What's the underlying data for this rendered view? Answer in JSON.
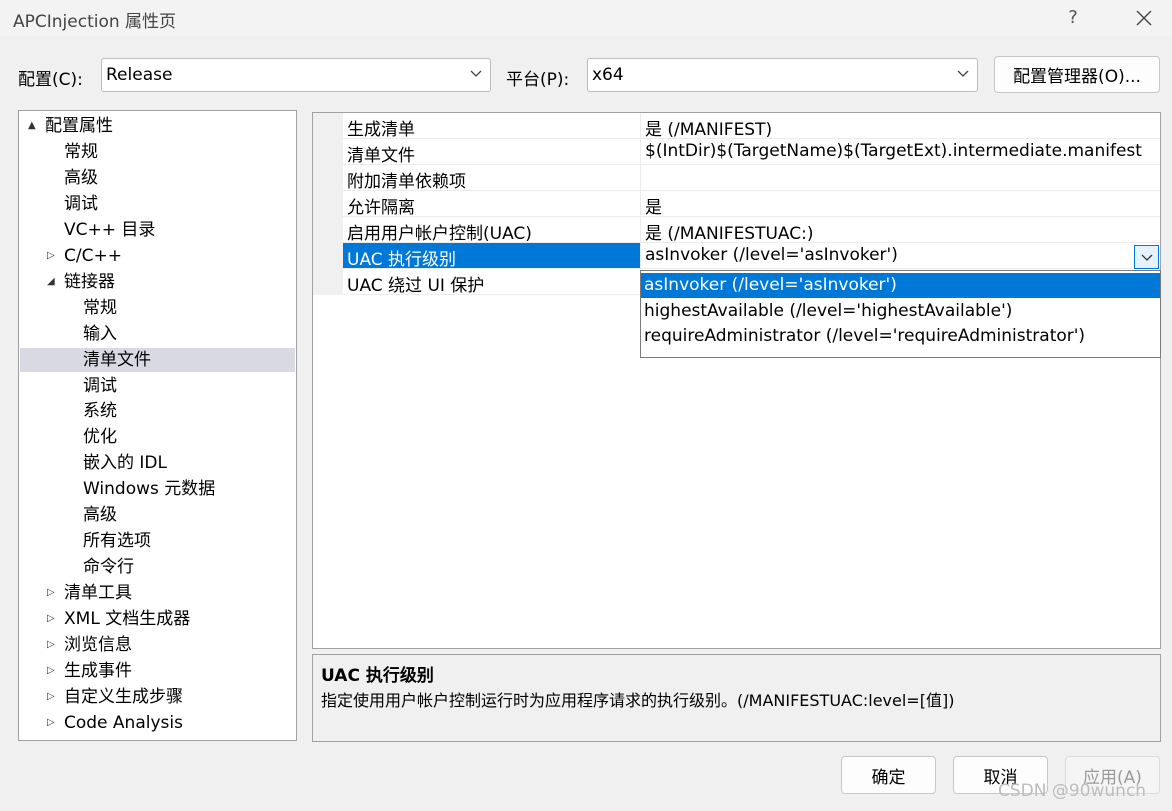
{
  "window": {
    "title": "APCInjection 属性页",
    "help_label": "?"
  },
  "config": {
    "configuration_label": "配置(C):",
    "configuration_value": "Release",
    "platform_label": "平台(P):",
    "platform_value": "x64",
    "manager_button": "配置管理器(O)..."
  },
  "tree": {
    "items": [
      {
        "label": "配置属性",
        "expander": "▲"
      },
      {
        "label": "常规"
      },
      {
        "label": "高级"
      },
      {
        "label": "调试"
      },
      {
        "label": "VC++ 目录"
      },
      {
        "label": "C/C++",
        "expander": "▷"
      },
      {
        "label": "链接器",
        "expander": "◢"
      },
      {
        "label": "常规"
      },
      {
        "label": "输入"
      },
      {
        "label": "清单文件",
        "selected": true
      },
      {
        "label": "调试"
      },
      {
        "label": "系统"
      },
      {
        "label": "优化"
      },
      {
        "label": "嵌入的 IDL"
      },
      {
        "label": "Windows 元数据"
      },
      {
        "label": "高级"
      },
      {
        "label": "所有选项"
      },
      {
        "label": "命令行"
      },
      {
        "label": "清单工具",
        "expander": "▷"
      },
      {
        "label": "XML 文档生成器",
        "expander": "▷"
      },
      {
        "label": "浏览信息",
        "expander": "▷"
      },
      {
        "label": "生成事件",
        "expander": "▷"
      },
      {
        "label": "自定义生成步骤",
        "expander": "▷"
      },
      {
        "label": "Code Analysis",
        "expander": "▷"
      }
    ]
  },
  "properties": {
    "rows": [
      {
        "name": "生成清单",
        "value": "是 (/MANIFEST)"
      },
      {
        "name": "清单文件",
        "value": "$(IntDir)$(TargetName)$(TargetExt).intermediate.manifest"
      },
      {
        "name": "附加清单依赖项",
        "value": ""
      },
      {
        "name": "允许隔离",
        "value": "是"
      },
      {
        "name": "启用用户帐户控制(UAC)",
        "value": "是 (/MANIFESTUAC:)"
      },
      {
        "name": "UAC 执行级别",
        "value": "asInvoker (/level='asInvoker')",
        "selected": true
      },
      {
        "name": "UAC 绕过 UI 保护",
        "value": ""
      }
    ],
    "dropdown_options": [
      "asInvoker (/level='asInvoker')",
      "highestAvailable (/level='highestAvailable')",
      "requireAdministrator (/level='requireAdministrator')"
    ],
    "selected_option_index": 0
  },
  "description": {
    "title": "UAC 执行级别",
    "text": "指定使用用户帐户控制运行时为应用程序请求的执行级别。(/MANIFESTUAC:level=[值])"
  },
  "buttons": {
    "ok": "确定",
    "cancel": "取消",
    "apply": "应用(A)"
  },
  "watermark": "CSDN @90wunch",
  "colors": {
    "selection": "#0078d7",
    "tree_selection": "#d9d9e4"
  }
}
